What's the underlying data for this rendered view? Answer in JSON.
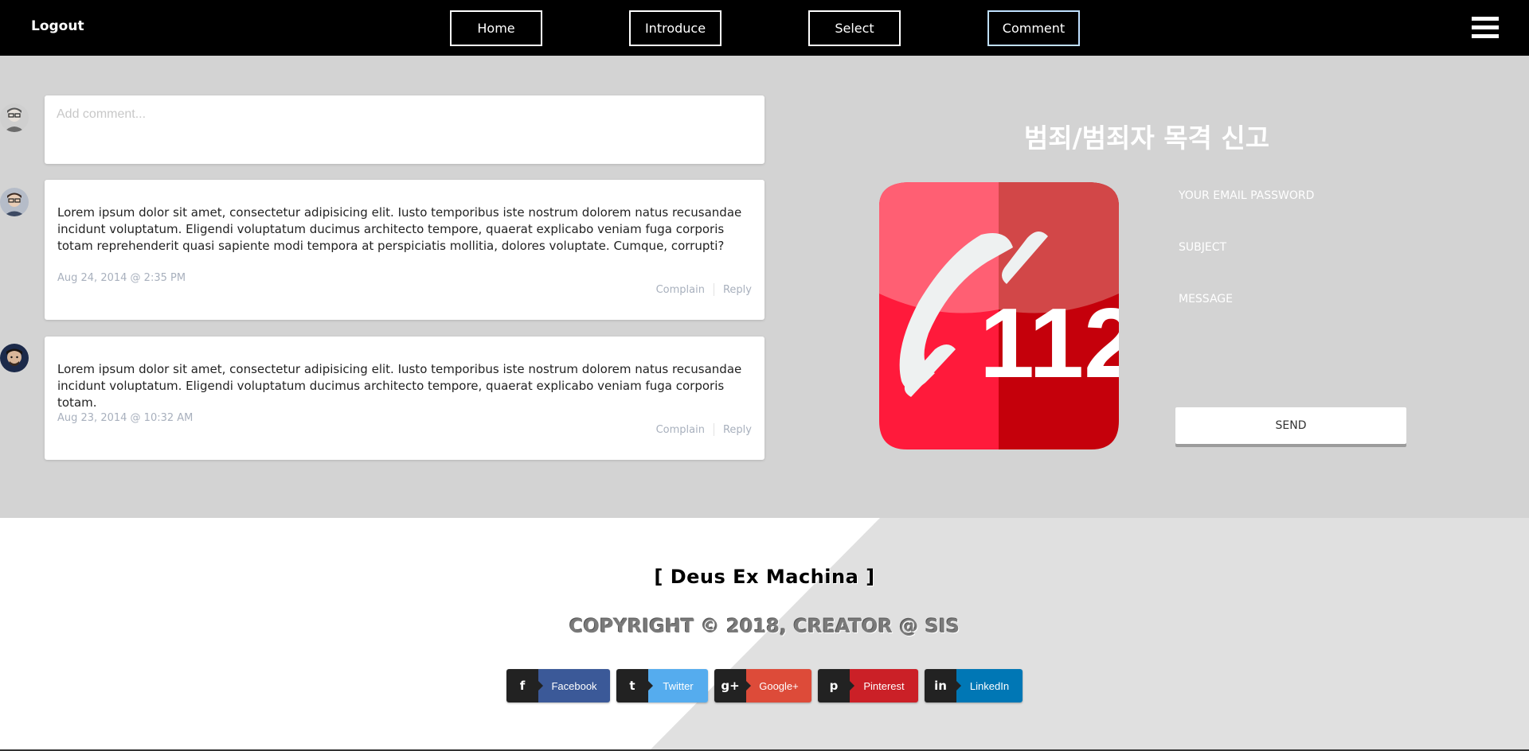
{
  "nav": {
    "logout": "Logout",
    "items": [
      {
        "label": "Home"
      },
      {
        "label": "Introduce"
      },
      {
        "label": "Select"
      },
      {
        "label": "Comment"
      }
    ],
    "active": "Comment",
    "menu_icon": "hamburger-menu-icon"
  },
  "comments": {
    "input_placeholder": "Add comment...",
    "list": [
      {
        "text": "Lorem ipsum dolor sit amet, consectetur adipisicing elit. Iusto temporibus iste nostrum dolorem natus recusandae incidunt voluptatum. Eligendi voluptatum ducimus architecto tempore, quaerat explicabo veniam fuga corporis totam reprehenderit quasi sapiente modi tempora at perspiciatis mollitia, dolores voluptate. Cumque, corrupti?",
        "date": "Aug 24, 2014 @ 2:35 PM",
        "complain": "Complain",
        "reply": "Reply"
      },
      {
        "text": "Lorem ipsum dolor sit amet, consectetur adipisicing elit. Iusto temporibus iste nostrum dolorem natus recusandae incidunt voluptatum. Eligendi voluptatum ducimus architecto tempore, quaerat explicabo veniam fuga corporis totam.",
        "date": "Aug 23, 2014 @ 10:32 AM",
        "complain": "Complain",
        "reply": "Reply"
      }
    ]
  },
  "report": {
    "title": "범죄/범죄자 목격 신고",
    "icon_number": "112",
    "email_placeholder": "YOUR EMAIL PASSWORD",
    "subject_placeholder": "SUBJECT",
    "message_placeholder": "MESSAGE",
    "send_label": "SEND"
  },
  "footer": {
    "brand": "[ Deus Ex Machina ]",
    "copyright": "COPYRIGHT © 2018, CREATOR @ SIS",
    "socials": [
      {
        "label": "Facebook",
        "icon": "facebook-icon",
        "glyph": "f",
        "color": "#3b5998"
      },
      {
        "label": "Twitter",
        "icon": "twitter-icon",
        "glyph": "t",
        "color": "#55acee"
      },
      {
        "label": "Google+",
        "icon": "google-plus-icon",
        "glyph": "g+",
        "color": "#dd4b39"
      },
      {
        "label": "Pinterest",
        "icon": "pinterest-icon",
        "glyph": "p",
        "color": "#cb2027"
      },
      {
        "label": "LinkedIn",
        "icon": "linkedin-icon",
        "glyph": "in",
        "color": "#0077b5"
      }
    ]
  }
}
